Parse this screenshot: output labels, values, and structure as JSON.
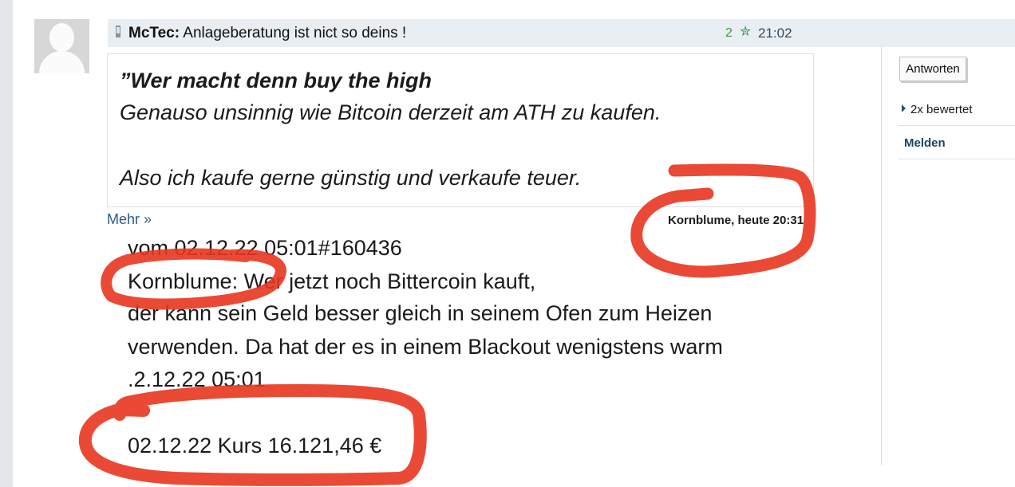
{
  "post": {
    "author": "McTec:",
    "title": "Anlageberatung ist nict so deins !",
    "rating": "2",
    "time": "21:02"
  },
  "quote": {
    "lines": [
      "”Wer macht denn buy the high",
      "Genauso unsinnig wie Bitcoin derzeit am ATH zu kaufen.",
      "Also ich kaufe gerne günstig und verkaufe teuer."
    ],
    "more_label": "Mehr »",
    "source": "Kornblume, heute 20:31"
  },
  "body": {
    "lines": [
      "vom 02.12.22 05:01#160436",
      "Kornblume: Wer jetzt noch Bittercoin kauft,",
      "der kann sein Geld besser gleich in seinem Ofen zum Heizen",
      "verwenden. Da hat der es in einem Blackout wenigstens warm",
      ".2.12.22 05:01",
      "02.12.22 Kurs 16.121,46 €"
    ]
  },
  "sidebar": {
    "reply_label": "Antworten",
    "rated_label": "2x bewertet",
    "report_label": "Melden"
  },
  "colors": {
    "annotation": "#e8361f",
    "header_bg": "#e9eef2",
    "rating": "#3b9c3e",
    "link": "#2b5c8a"
  },
  "icons": [
    "phone-icon",
    "star-icon",
    "caret-right-icon",
    "avatar-placeholder-icon"
  ]
}
